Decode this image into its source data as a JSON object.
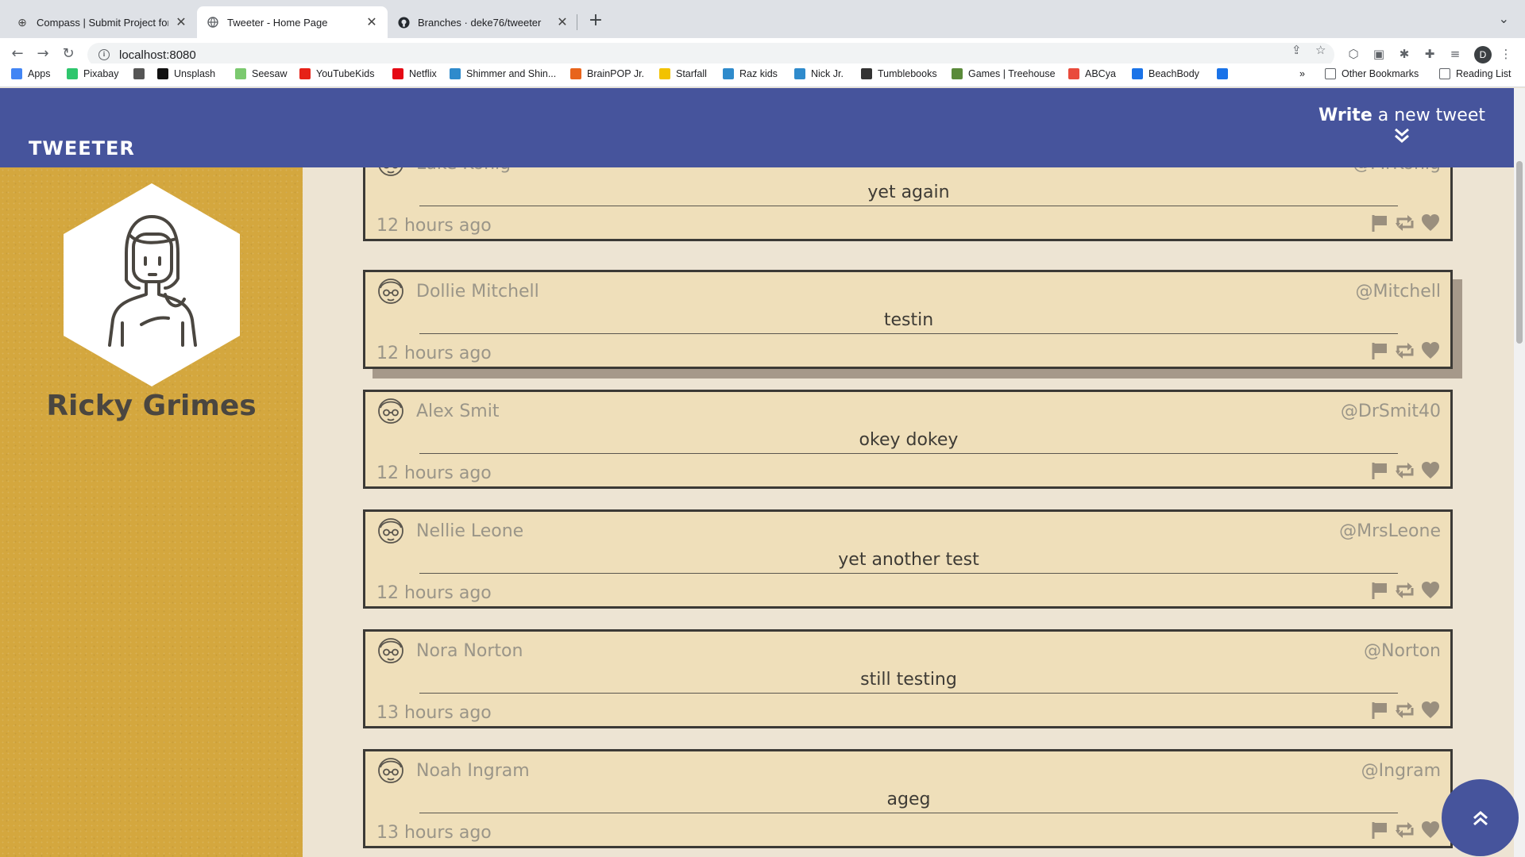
{
  "browser": {
    "tabs": [
      {
        "title": "Compass | Submit Project for E",
        "active": false
      },
      {
        "title": "Tweeter - Home Page",
        "active": true
      },
      {
        "title": "Branches · deke76/tweeter",
        "active": false
      }
    ],
    "url": "localhost:8080",
    "profile_initial": "D",
    "bookmarks": [
      {
        "label": "Apps",
        "icon": "apps-grid-icon",
        "color": "#4285f4"
      },
      {
        "label": "Pixabay",
        "icon": "pixabay-icon",
        "color": "#2ec66d"
      },
      {
        "label": "",
        "icon": "roblox-icon",
        "color": "#555555"
      },
      {
        "label": "Unsplash",
        "icon": "unsplash-icon",
        "color": "#111111"
      },
      {
        "label": "Seesaw",
        "icon": "seesaw-icon",
        "color": "#7bc96f"
      },
      {
        "label": "YouTubeKids",
        "icon": "youtube-kids-icon",
        "color": "#e62117"
      },
      {
        "label": "Netflix",
        "icon": "netflix-icon",
        "color": "#e50914"
      },
      {
        "label": "Shimmer and Shin...",
        "icon": "nickjr-icon",
        "color": "#2f8bcc"
      },
      {
        "label": "BrainPOP Jr.",
        "icon": "brainpop-icon",
        "color": "#e8641b"
      },
      {
        "label": "Starfall",
        "icon": "starfall-icon",
        "color": "#f2c200"
      },
      {
        "label": "Raz kids",
        "icon": "razkids-icon",
        "color": "#2f8bcc"
      },
      {
        "label": "Nick Jr.",
        "icon": "nickjr-icon",
        "color": "#2f8bcc"
      },
      {
        "label": "Tumblebooks",
        "icon": "tumblebooks-icon",
        "color": "#333333"
      },
      {
        "label": "Games | Treehouse",
        "icon": "treehouse-icon",
        "color": "#5a8a3a"
      },
      {
        "label": "ABCya",
        "icon": "abcya-icon",
        "color": "#e94b3c"
      },
      {
        "label": "BeachBody",
        "icon": "beachbody-icon",
        "color": "#1a73e8"
      },
      {
        "label": "",
        "icon": "b-icon",
        "color": "#1a73e8"
      }
    ],
    "other_bookmarks": "Other Bookmarks",
    "reading_list": "Reading List"
  },
  "header": {
    "logo": "TWEETER",
    "compose_bold": "Write",
    "compose_rest": " a new tweet"
  },
  "profile": {
    "name": "Ricky Grimes"
  },
  "tweets": [
    {
      "name": "Luke Konig",
      "handle": "@MrKonig",
      "content": "yet again",
      "time": "12 hours ago"
    },
    {
      "name": "Dollie Mitchell",
      "handle": "@Mitchell",
      "content": "testin",
      "time": "12 hours ago"
    },
    {
      "name": "Alex Smit",
      "handle": "@DrSmit40",
      "content": "okey dokey",
      "time": "12 hours ago"
    },
    {
      "name": "Nellie Leone",
      "handle": "@MrsLeone",
      "content": "yet another test",
      "time": "12 hours ago"
    },
    {
      "name": "Nora Norton",
      "handle": "@Norton",
      "content": "still testing",
      "time": "13 hours ago"
    },
    {
      "name": "Noah Ingram",
      "handle": "@Ingram",
      "content": "ageg",
      "time": "13 hours ago"
    }
  ],
  "colors": {
    "header_bg": "#46549c",
    "sidebar_bg": "#d4a73e",
    "main_bg": "#ede4d3",
    "tweet_bg": "#efdfba",
    "tweet_border": "#3c3a36"
  }
}
